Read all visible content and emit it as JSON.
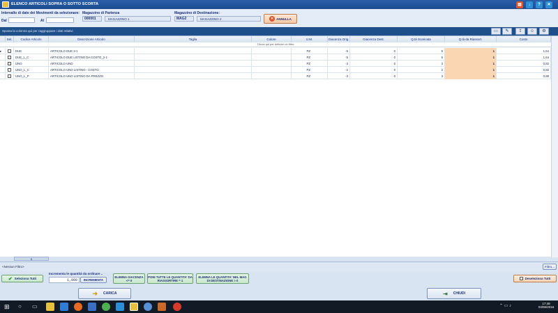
{
  "window": {
    "title": "ELENCO ARTICOLI SOPRA O SOTTO SCORTA",
    "colors": {
      "titlebar": "#1b4c93",
      "accent_qty": "#fbd6b2",
      "cancel": "#d9542b"
    }
  },
  "header": {
    "interval_label": "Intervallo di date dei Movimenti da selezionare:",
    "from_label": "Dal",
    "to_label": "Al",
    "from_value": "",
    "to_value": "",
    "source_label": "Magazzino di Partenza",
    "source_code": "000001",
    "source_name": "MAGAZZINO 1",
    "dest_label": "Magazzino di Destinazione:",
    "dest_code": "MAG2",
    "dest_name": "MAGAZZINO 2",
    "cancel_label": "ANNULLA"
  },
  "groupbar": {
    "hint": "Sposta la colonna qui per raggruppare i dati relativi",
    "tools": [
      "printer-icon",
      "eraser-icon",
      "export-icon",
      "users-icon",
      "settings-icon"
    ]
  },
  "grid": {
    "columns": [
      "Sel.",
      "Codice Articolo",
      "Descrizione Articolo",
      "Taglia",
      "Colore",
      "U.M.",
      "Giacenza Orig.",
      "Giacenza Dest.",
      "Q.tà Scaricata",
      "Q.tà da Riassort.",
      "Costo"
    ],
    "filter_hint": "Clicca qui per definire un filtro",
    "rows": [
      {
        "code": "DUE",
        "desc": "ARTICOLO DUE 2-1",
        "size": "",
        "color": "",
        "um": "PZ",
        "orig": "-5",
        "dest": "0",
        "scaricata": "5",
        "riassort": "1",
        "cost": "1,64"
      },
      {
        "code": "DUE_L_C",
        "desc": "ARTICOLO DUE LISTINO DA COSTO_2-1",
        "size": "",
        "color": "",
        "um": "PZ",
        "orig": "-5",
        "dest": "0",
        "scaricata": "5",
        "riassort": "1",
        "cost": "1,64"
      },
      {
        "code": "UNO",
        "desc": "ARTICOLO UNO",
        "size": "",
        "color": "",
        "um": "PZ",
        "orig": "-3",
        "dest": "0",
        "scaricata": "3",
        "riassort": "1",
        "cost": "0,82"
      },
      {
        "code": "UNO_L_C",
        "desc": "ARTICOLO UNO LISTINO - COSTO",
        "size": "",
        "color": "",
        "um": "PZ",
        "orig": "-2",
        "dest": "0",
        "scaricata": "2",
        "riassort": "1",
        "cost": "0,82"
      },
      {
        "code": "UNO_L_P",
        "desc": "ARTICOLO UNO LISTINO DA PREZZO",
        "size": "",
        "color": "",
        "um": "PZ",
        "orig": "-3",
        "dest": "0",
        "scaricata": "3",
        "riassort": "1",
        "cost": "0,98"
      }
    ],
    "row_count": "5"
  },
  "filterbar": {
    "status": "<Nessun Filtro>",
    "button": "Filtro..."
  },
  "actions": {
    "select_all": "Seleziona Tutti",
    "increment_label": "Incrementa le quantità da ordinare ..",
    "increment_value": "1,000",
    "increment_button": "INCREMENTA",
    "delete_stock": "ELIMINA GIACENZA <= 0",
    "set_all": "PONI TUTTE LE QUANTITA' DA RIASSORTIRE = 1",
    "delete_dest": "ELIMINA LE QUANTITA' NEL MAG DI DESTINAZIONE > 0",
    "deselect_all": "Deseleziona Tutti",
    "load": "CARICA",
    "close": "CHIUDI"
  },
  "taskbar": {
    "time": "17:48",
    "date": "03/06/2016"
  }
}
